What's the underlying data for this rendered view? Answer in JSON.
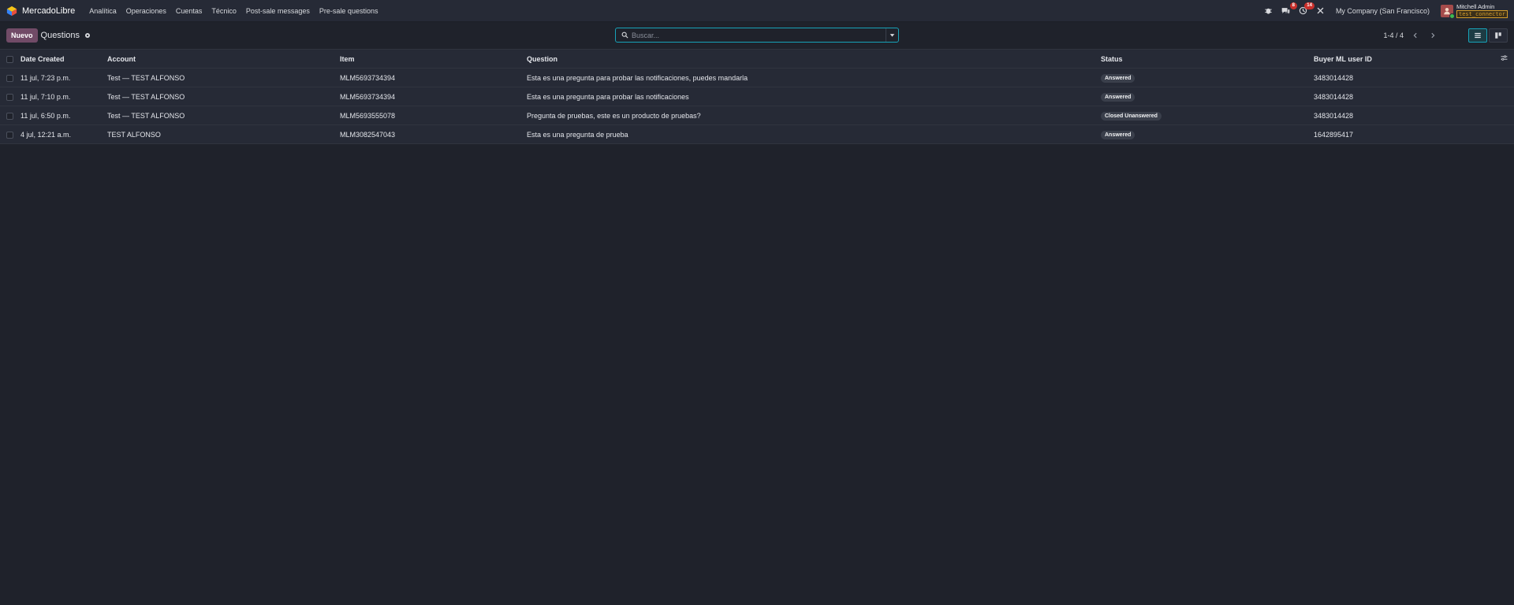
{
  "navbar": {
    "brand": "MercadoLibre",
    "menu": [
      "Analítica",
      "Operaciones",
      "Cuentas",
      "Técnico",
      "Post-sale messages",
      "Pre-sale questions"
    ],
    "messages_badge": "8",
    "activity_badge": "14",
    "company": "My Company (San Francisco)",
    "user_name": "Mitchell Admin",
    "user_db": "test_connector"
  },
  "control": {
    "new_label": "Nuevo",
    "title": "Questions",
    "search_placeholder": "Buscar...",
    "pager": "1-4 / 4"
  },
  "table": {
    "columns": [
      "Date Created",
      "Account",
      "Item",
      "Question",
      "Status",
      "Buyer ML user ID"
    ],
    "rows": [
      {
        "date": "11 jul, 7:23 p.m.",
        "account": "Test — TEST ALFONSO",
        "item": "MLM5693734394",
        "question": "Esta es una pregunta para probar las notificaciones, puedes mandarla",
        "status": "Answered",
        "buyer": "3483014428"
      },
      {
        "date": "11 jul, 7:10 p.m.",
        "account": "Test — TEST ALFONSO",
        "item": "MLM5693734394",
        "question": "Esta es una pregunta para probar las notificaciones",
        "status": "Answered",
        "buyer": "3483014428"
      },
      {
        "date": "11 jul, 6:50 p.m.",
        "account": "Test — TEST ALFONSO",
        "item": "MLM5693555078",
        "question": "Pregunta de pruebas, este es un producto de pruebas?",
        "status": "Closed Unanswered",
        "buyer": "3483014428"
      },
      {
        "date": "4 jul, 12:21 a.m.",
        "account": "TEST ALFONSO",
        "item": "MLM3082547043",
        "question": "Esta es una pregunta de prueba",
        "status": "Answered",
        "buyer": "1642895417"
      }
    ]
  }
}
